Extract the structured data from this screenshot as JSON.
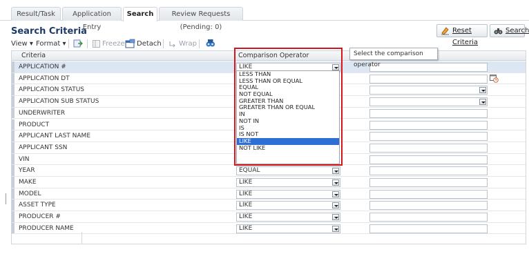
{
  "tabs": [
    {
      "label": "Result/Task",
      "active": false
    },
    {
      "label": "Application Entry",
      "active": false
    },
    {
      "label": "Search",
      "active": true
    },
    {
      "label": "Review Requests (Pending: 0)",
      "active": false
    }
  ],
  "page_title": "Search Criteria",
  "buttons": {
    "reset": "Reset Criteria",
    "search": "Search"
  },
  "toolbar": {
    "view": "View",
    "format": "Format",
    "freeze": "Freeze",
    "detach": "Detach",
    "wrap": "Wrap"
  },
  "grid": {
    "headers": {
      "criteria": "Criteria",
      "operator": "Comparison Operator"
    },
    "rows": [
      {
        "criteria": "APPLICATION #",
        "operator": "LIKE",
        "value_type": "text",
        "selected": true
      },
      {
        "criteria": "APPLICATION DT",
        "operator": "",
        "value_type": "date"
      },
      {
        "criteria": "APPLICATION STATUS",
        "operator": "",
        "value_type": "select"
      },
      {
        "criteria": "APPLICATION SUB STATUS",
        "operator": "",
        "value_type": "select"
      },
      {
        "criteria": "UNDERWRITER",
        "operator": "",
        "value_type": "text"
      },
      {
        "criteria": "PRODUCT",
        "operator": "",
        "value_type": "text"
      },
      {
        "criteria": "APPLICANT LAST NAME",
        "operator": "",
        "value_type": "text"
      },
      {
        "criteria": "APPLICANT SSN",
        "operator": "",
        "value_type": "text"
      },
      {
        "criteria": "VIN",
        "operator": "",
        "value_type": "text"
      },
      {
        "criteria": "YEAR",
        "operator": "EQUAL",
        "value_type": "text"
      },
      {
        "criteria": "MAKE",
        "operator": "LIKE",
        "value_type": "text"
      },
      {
        "criteria": "MODEL",
        "operator": "LIKE",
        "value_type": "text"
      },
      {
        "criteria": "ASSET TYPE",
        "operator": "LIKE",
        "value_type": "text"
      },
      {
        "criteria": "PRODUCER #",
        "operator": "LIKE",
        "value_type": "text"
      },
      {
        "criteria": "PRODUCER NAME",
        "operator": "LIKE",
        "value_type": "text"
      }
    ]
  },
  "dropdown": {
    "options": [
      "LESS THAN",
      "LESS THAN OR EQUAL",
      "EQUAL",
      "NOT EQUAL",
      "GREATER THAN",
      "GREATER THAN OR EQUAL",
      "IN",
      "NOT IN",
      "IS",
      "IS NOT",
      "LIKE",
      "NOT LIKE"
    ],
    "highlighted": "LIKE"
  },
  "tooltip": "Select the comparison operator",
  "colors": {
    "title": "#1d3b66",
    "highlight": "#2e6fd6",
    "callout": "#d4131b",
    "selected_row": "#dde7f3"
  }
}
